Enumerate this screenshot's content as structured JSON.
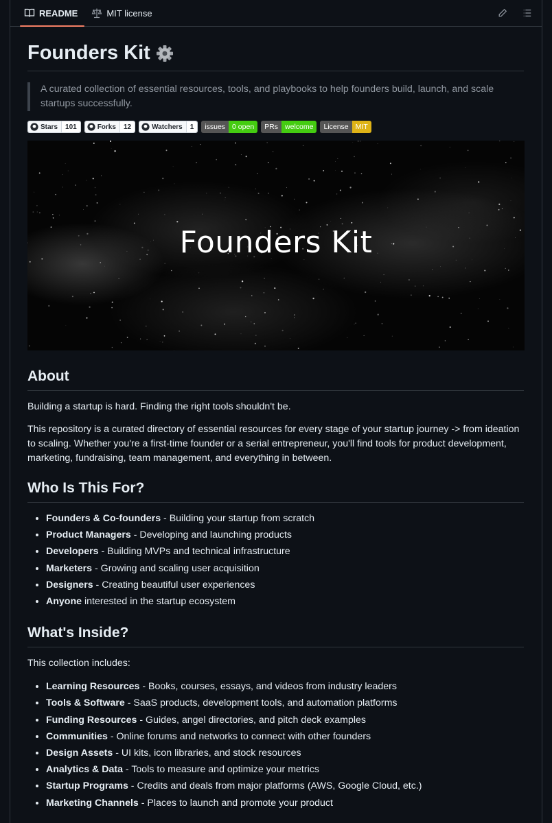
{
  "tabs": [
    {
      "label": "README",
      "icon": "book-icon",
      "active": true
    },
    {
      "label": "MIT license",
      "icon": "scale-icon",
      "active": false
    }
  ],
  "toolbar": {
    "edit_icon": "pencil-icon",
    "outline_icon": "list-icon"
  },
  "title": "Founders Kit",
  "title_emoji": "gear-icon",
  "description": "A curated collection of essential resources, tools, and playbooks to help founders build, launch, and scale startups successfully.",
  "badges": {
    "github": [
      {
        "label": "Stars",
        "value": "101"
      },
      {
        "label": "Forks",
        "value": "12"
      },
      {
        "label": "Watchers",
        "value": "1"
      }
    ],
    "shields": [
      {
        "label": "issues",
        "value": "0 open",
        "color": "#4c1"
      },
      {
        "label": "PRs",
        "value": "welcome",
        "color": "#4c1"
      },
      {
        "label": "License",
        "value": "MIT",
        "color": "#dfb317"
      }
    ]
  },
  "banner_text": "Founders Kit",
  "about": {
    "heading": "About",
    "p1": "Building a startup is hard. Finding the right tools shouldn't be.",
    "p2": "This repository is a curated directory of essential resources for every stage of your startup journey -> from ideation to scaling. Whether you're a first-time founder or a serial entrepreneur, you'll find tools for product development, marketing, fundraising, team management, and everything in between."
  },
  "who": {
    "heading": "Who Is This For?",
    "items": [
      {
        "bold": "Founders & Co-founders",
        "text": " - Building your startup from scratch"
      },
      {
        "bold": "Product Managers",
        "text": " - Developing and launching products"
      },
      {
        "bold": "Developers",
        "text": " - Building MVPs and technical infrastructure"
      },
      {
        "bold": "Marketers",
        "text": " - Growing and scaling user acquisition"
      },
      {
        "bold": "Designers",
        "text": " - Creating beautiful user experiences"
      },
      {
        "bold": "Anyone",
        "text": " interested in the startup ecosystem"
      }
    ]
  },
  "inside": {
    "heading": "What's Inside?",
    "intro": "This collection includes:",
    "items": [
      {
        "bold": "Learning Resources",
        "text": " - Books, courses, essays, and videos from industry leaders"
      },
      {
        "bold": "Tools & Software",
        "text": " - SaaS products, development tools, and automation platforms"
      },
      {
        "bold": "Funding Resources",
        "text": " - Guides, angel directories, and pitch deck examples"
      },
      {
        "bold": "Communities",
        "text": " - Online forums and networks to connect with other founders"
      },
      {
        "bold": "Design Assets",
        "text": " - UI kits, icon libraries, and stock resources"
      },
      {
        "bold": "Analytics & Data",
        "text": " - Tools to measure and optimize your metrics"
      },
      {
        "bold": "Startup Programs",
        "text": " - Credits and deals from major platforms (AWS, Google Cloud, etc.)"
      },
      {
        "bold": "Marketing Channels",
        "text": " - Places to launch and promote your product"
      }
    ]
  }
}
